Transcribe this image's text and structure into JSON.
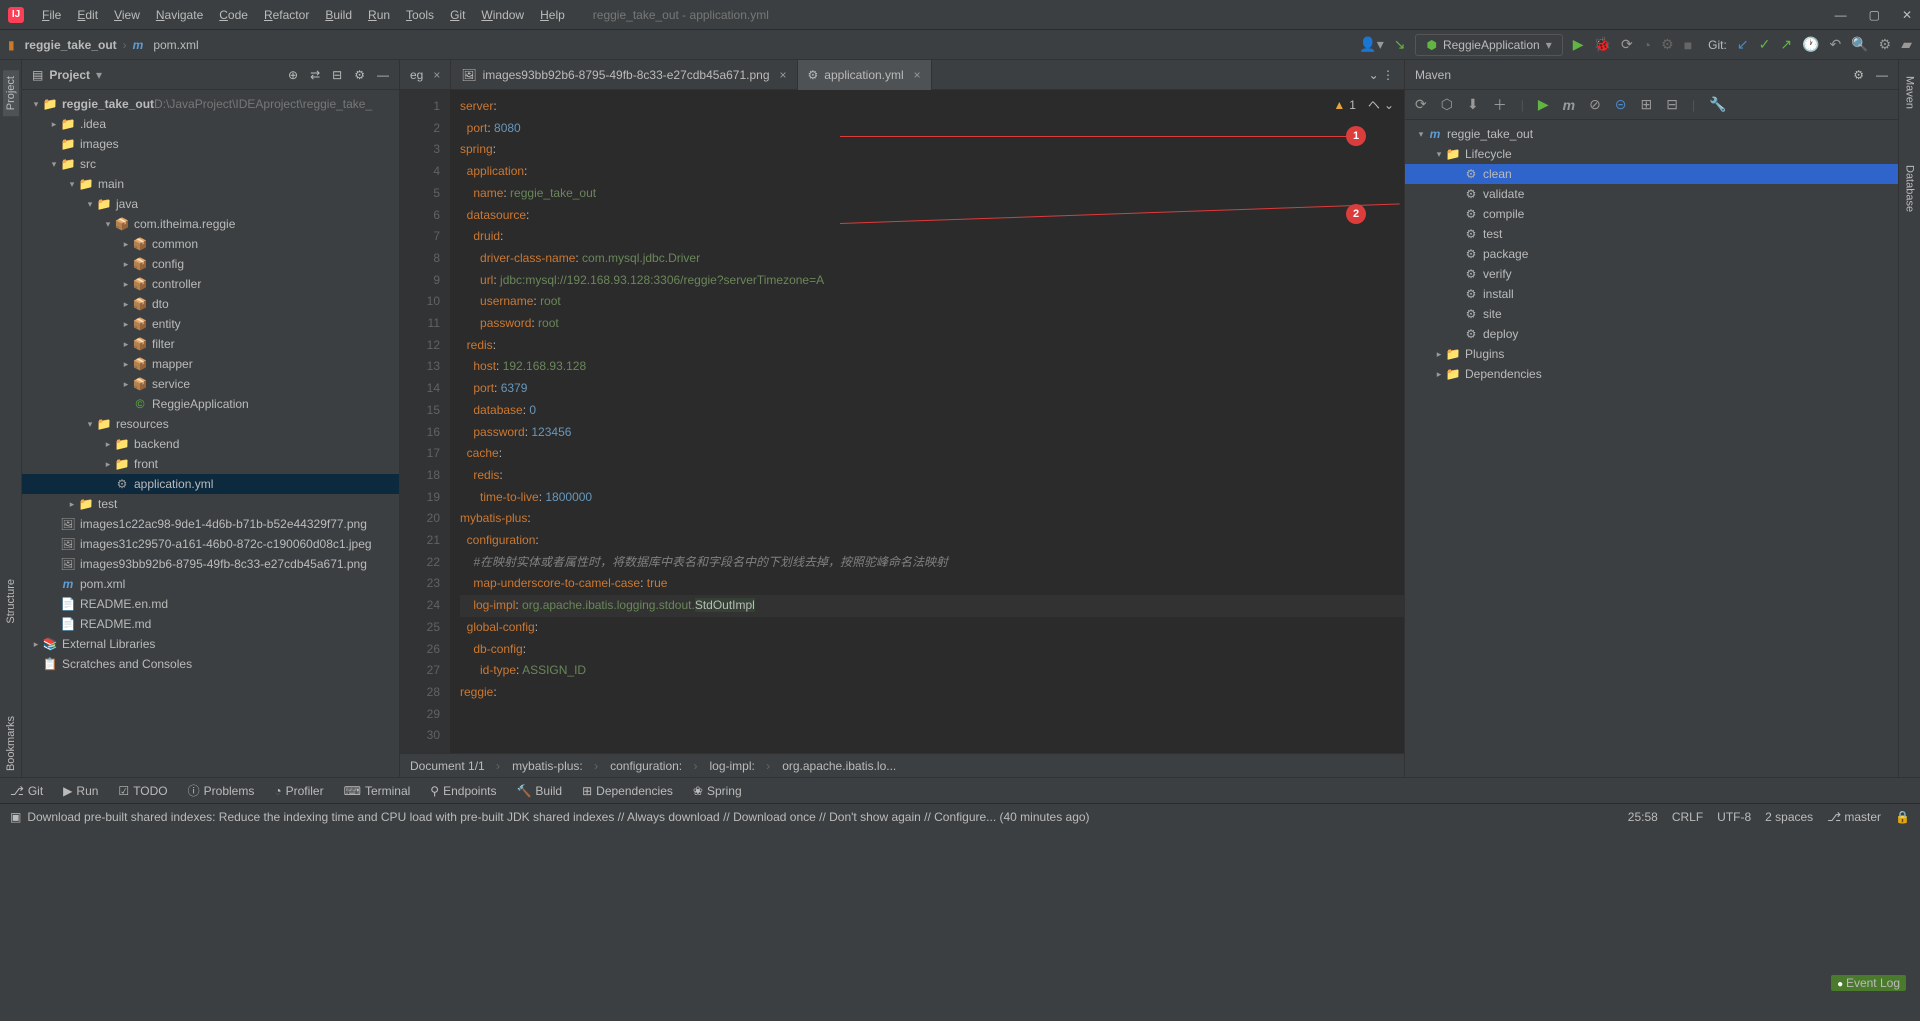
{
  "window": {
    "title": "reggie_take_out - application.yml"
  },
  "menubar": [
    "File",
    "Edit",
    "View",
    "Navigate",
    "Code",
    "Refactor",
    "Build",
    "Run",
    "Tools",
    "Git",
    "Window",
    "Help"
  ],
  "breadcrumb": {
    "project": "reggie_take_out",
    "file": "pom.xml"
  },
  "runconfig": "ReggieApplication",
  "git_label": "Git:",
  "project_panel": {
    "title": "Project",
    "root_path": "D:\\JavaProject\\IDEAproject\\reggie_take_",
    "tree": [
      {
        "d": 0,
        "a": "exp",
        "i": "📁",
        "t": "reggie_take_out",
        "bold": true
      },
      {
        "d": 1,
        "a": "col",
        "i": "📁",
        "t": ".idea"
      },
      {
        "d": 1,
        "a": "",
        "i": "📁",
        "t": "images"
      },
      {
        "d": 1,
        "a": "exp",
        "i": "📁",
        "t": "src"
      },
      {
        "d": 2,
        "a": "exp",
        "i": "📁",
        "t": "main"
      },
      {
        "d": 3,
        "a": "exp",
        "i": "📁",
        "t": "java",
        "blue": true
      },
      {
        "d": 4,
        "a": "exp",
        "i": "📦",
        "t": "com.itheima.reggie"
      },
      {
        "d": 5,
        "a": "col",
        "i": "📦",
        "t": "common"
      },
      {
        "d": 5,
        "a": "col",
        "i": "📦",
        "t": "config"
      },
      {
        "d": 5,
        "a": "col",
        "i": "📦",
        "t": "controller"
      },
      {
        "d": 5,
        "a": "col",
        "i": "📦",
        "t": "dto"
      },
      {
        "d": 5,
        "a": "col",
        "i": "📦",
        "t": "entity"
      },
      {
        "d": 5,
        "a": "col",
        "i": "📦",
        "t": "filter"
      },
      {
        "d": 5,
        "a": "col",
        "i": "📦",
        "t": "mapper"
      },
      {
        "d": 5,
        "a": "col",
        "i": "📦",
        "t": "service"
      },
      {
        "d": 5,
        "a": "",
        "i": "©",
        "t": "ReggieApplication",
        "green": true
      },
      {
        "d": 3,
        "a": "exp",
        "i": "📁",
        "t": "resources"
      },
      {
        "d": 4,
        "a": "col",
        "i": "📁",
        "t": "backend"
      },
      {
        "d": 4,
        "a": "col",
        "i": "📁",
        "t": "front"
      },
      {
        "d": 4,
        "a": "",
        "i": "⚙",
        "t": "application.yml",
        "sel": true
      },
      {
        "d": 2,
        "a": "col",
        "i": "📁",
        "t": "test"
      },
      {
        "d": 1,
        "a": "",
        "i": "🖼",
        "t": "images1c22ac98-9de1-4d6b-b71b-b52e44329f77.png"
      },
      {
        "d": 1,
        "a": "",
        "i": "🖼",
        "t": "images31c29570-a161-46b0-872c-c190060d08c1.jpeg"
      },
      {
        "d": 1,
        "a": "",
        "i": "🖼",
        "t": "images93bb92b6-8795-49fb-8c33-e27cdb45a671.png"
      },
      {
        "d": 1,
        "a": "",
        "i": "m",
        "t": "pom.xml",
        "micon": true
      },
      {
        "d": 1,
        "a": "",
        "i": "📄",
        "t": "README.en.md"
      },
      {
        "d": 1,
        "a": "",
        "i": "📄",
        "t": "README.md"
      },
      {
        "d": 0,
        "a": "col",
        "i": "📚",
        "t": "External Libraries"
      },
      {
        "d": 0,
        "a": "",
        "i": "📋",
        "t": "Scratches and Consoles"
      }
    ]
  },
  "editor_tabs": [
    {
      "label": "eg",
      "active": false,
      "icon": ""
    },
    {
      "label": "images93bb92b6-8795-49fb-8c33-e27cdb45a671.png",
      "active": false,
      "icon": "🖼"
    },
    {
      "label": "application.yml",
      "active": true,
      "icon": "⚙"
    }
  ],
  "code_lines": [
    "<span class='k'>server</span>:",
    "  <span class='k'>port</span>: <span class='n'>8080</span>",
    "<span class='k'>spring</span>:",
    "  <span class='k'>application</span>:",
    "    <span class='k'>name</span>: <span class='s'>reggie_take_out</span>",
    "  <span class='k'>datasource</span>:",
    "    <span class='k'>druid</span>:",
    "      <span class='k'>driver-class-name</span>: <span class='s'>com.mysql.jdbc.Driver</span>",
    "      <span class='k'>url</span>: <span class='s'>jdbc:mysql://192.168.93.128:3306/reggie?serverTimezone=A</span>",
    "      <span class='k'>username</span>: <span class='s'>root</span>",
    "      <span class='k'>password</span>: <span class='s'>root</span>",
    "  <span class='k'>redis</span>:",
    "    <span class='k'>host</span>: <span class='s'>192.168.93.128</span>",
    "    <span class='k'>port</span>: <span class='n'>6379</span>",
    "    <span class='k'>database</span>: <span class='n'>0</span>",
    "    <span class='k'>password</span>: <span class='n'>123456</span>",
    "  <span class='k'>cache</span>:",
    "    <span class='k'>redis</span>:",
    "      <span class='k'>time-to-live</span>: <span class='n'>1800000</span>",
    "",
    "<span class='k'>mybatis-plus</span>:",
    "  <span class='k'>configuration</span>:",
    "    <span class='c'>#在映射实体或者属性时，将数据库中表名和字段名中的下划线去掉，按照驼峰命名法映射</span>",
    "    <span class='k'>map-underscore-to-camel-case</span>: <span class='k'>true</span>",
    "    <span class='k'>log-impl</span>: <span class='s'>org.apache.ibatis.logging.stdout.</span><span style='background:#344134'>StdOutImpl</span>",
    "  <span class='k'>global-config</span>:",
    "    <span class='k'>db-config</span>:",
    "      <span class='k'>id-type</span>: <span class='s'>ASSIGN_ID</span>",
    "",
    "<span class='k'>reggie</span>:"
  ],
  "warn_count": "1",
  "editor_crumbs": [
    "Document 1/1",
    "mybatis-plus:",
    "configuration:",
    "log-impl:",
    "org.apache.ibatis.lo..."
  ],
  "maven": {
    "title": "Maven",
    "tree": [
      {
        "d": 0,
        "a": "exp",
        "i": "m",
        "t": "reggie_take_out"
      },
      {
        "d": 1,
        "a": "exp",
        "i": "📁",
        "t": "Lifecycle"
      },
      {
        "d": 2,
        "a": "",
        "i": "⚙",
        "t": "clean",
        "sel": true
      },
      {
        "d": 2,
        "a": "",
        "i": "⚙",
        "t": "validate"
      },
      {
        "d": 2,
        "a": "",
        "i": "⚙",
        "t": "compile"
      },
      {
        "d": 2,
        "a": "",
        "i": "⚙",
        "t": "test"
      },
      {
        "d": 2,
        "a": "",
        "i": "⚙",
        "t": "package"
      },
      {
        "d": 2,
        "a": "",
        "i": "⚙",
        "t": "verify"
      },
      {
        "d": 2,
        "a": "",
        "i": "⚙",
        "t": "install"
      },
      {
        "d": 2,
        "a": "",
        "i": "⚙",
        "t": "site"
      },
      {
        "d": 2,
        "a": "",
        "i": "⚙",
        "t": "deploy"
      },
      {
        "d": 1,
        "a": "col",
        "i": "📁",
        "t": "Plugins"
      },
      {
        "d": 1,
        "a": "col",
        "i": "📁",
        "t": "Dependencies"
      }
    ]
  },
  "left_tabs": [
    "Project",
    "Structure",
    "Bookmarks"
  ],
  "right_tabs": [
    "Maven",
    "Database"
  ],
  "bottom_tools": [
    "Git",
    "Run",
    "TODO",
    "Problems",
    "Profiler",
    "Terminal",
    "Endpoints",
    "Build",
    "Dependencies",
    "Spring"
  ],
  "event_log": "Event Log",
  "status_msg": "Download pre-built shared indexes: Reduce the indexing time and CPU load with pre-built JDK shared indexes // Always download // Download once // Don't show again // Configure... (40 minutes ago)",
  "status_right": {
    "pos": "25:58",
    "sep": "CRLF",
    "enc": "UTF-8",
    "indent": "2 spaces",
    "branch": "master"
  }
}
